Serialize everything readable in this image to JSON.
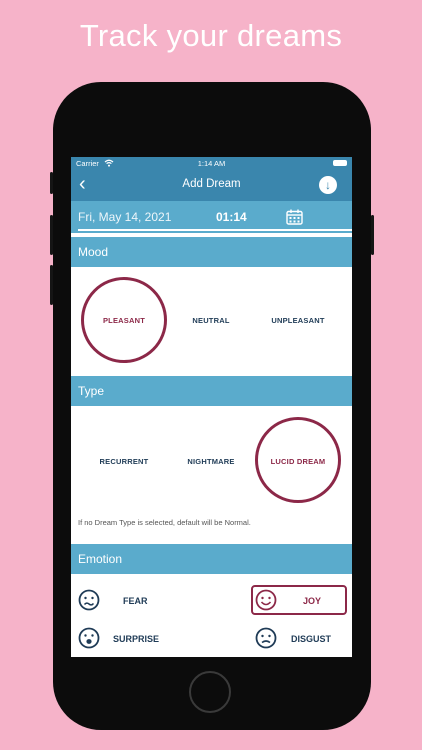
{
  "headline": "Track your dreams",
  "status_bar": {
    "carrier": "Carrier",
    "time": "1:14 AM"
  },
  "nav": {
    "back_icon": "chevron-left-icon",
    "title": "Add Dream",
    "action_icon": "download-icon"
  },
  "date_bar": {
    "date": "Fri, May 14, 2021",
    "time": "01:14",
    "calendar_icon": "calendar-icon"
  },
  "mood": {
    "header": "Mood",
    "options": [
      "PLEASANT",
      "NEUTRAL",
      "UNPLEASANT"
    ],
    "selected": "PLEASANT"
  },
  "type": {
    "header": "Type",
    "options": [
      "RECURRENT",
      "NIGHTMARE",
      "LUCID DREAM"
    ],
    "selected": "LUCID DREAM",
    "note": "If no Dream Type is selected, default will be Normal."
  },
  "emotion": {
    "header": "Emotion",
    "options": [
      {
        "label": "FEAR",
        "icon": "worried-face-icon"
      },
      {
        "label": "JOY",
        "icon": "smiley-face-icon"
      },
      {
        "label": "SURPRISE",
        "icon": "surprised-face-icon"
      },
      {
        "label": "DISGUST",
        "icon": "disgusted-face-icon"
      }
    ],
    "selected": "JOY"
  },
  "colors": {
    "background": "#f6b3c9",
    "header_blue": "#3a86ad",
    "section_blue": "#5aabcc",
    "selection": "#8c2848",
    "text_dark": "#1f3b56"
  }
}
